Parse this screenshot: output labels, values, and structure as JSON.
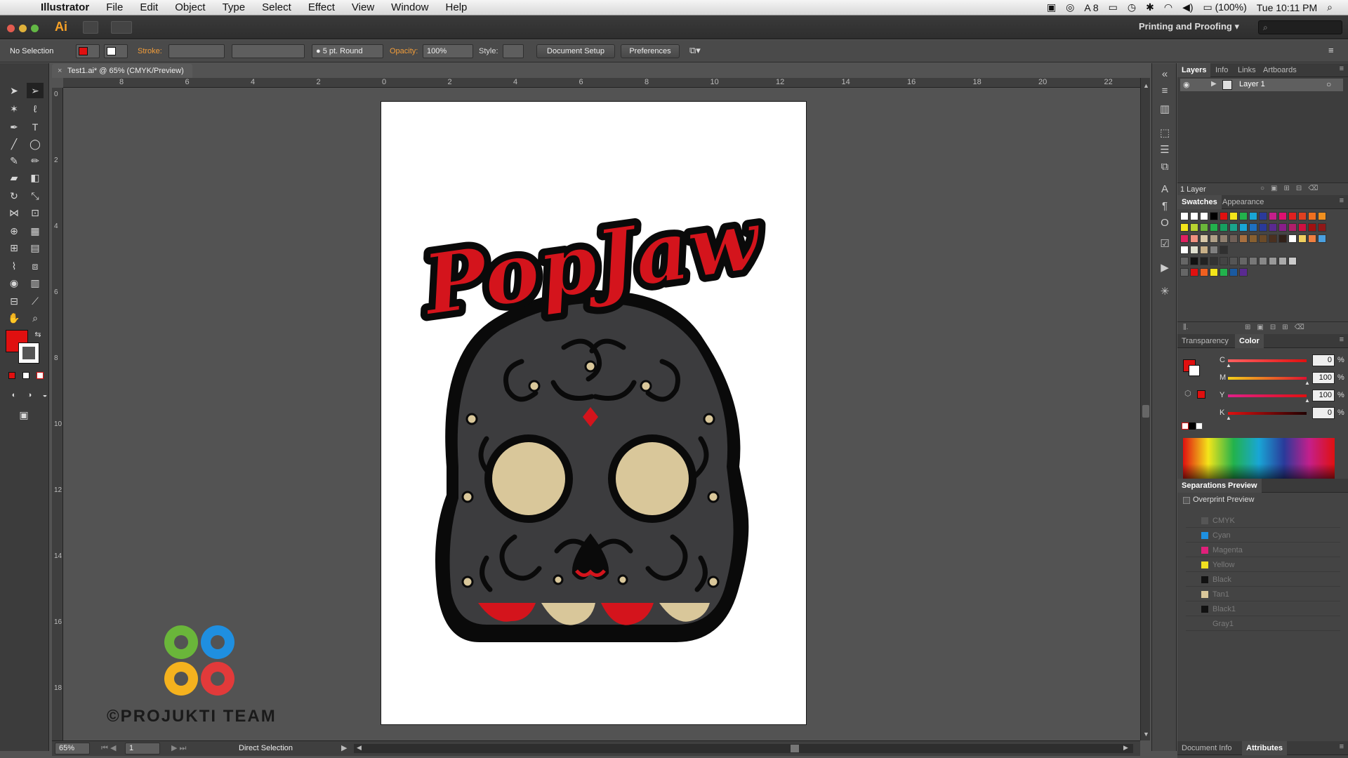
{
  "menubar": {
    "app_name": "Illustrator",
    "items": [
      "File",
      "Edit",
      "Object",
      "Type",
      "Select",
      "Effect",
      "View",
      "Window",
      "Help"
    ],
    "battery": "(100%)",
    "clock": "Tue 10:11 PM",
    "adobe_updates": "8"
  },
  "appbar": {
    "logo": "Ai",
    "workspace": "Printing and Proofing",
    "search_placeholder": "⌕"
  },
  "controlbar": {
    "selection": "No Selection",
    "stroke_label": "Stroke:",
    "brush": "5 pt. Round",
    "opacity_label": "Opacity:",
    "opacity_value": "100%",
    "style_label": "Style:",
    "doc_setup": "Document Setup",
    "preferences": "Preferences"
  },
  "document": {
    "tab_title": "Test1.ai* @ 65% (CMYK/Preview)",
    "ruler_top": [
      "8",
      "6",
      "4",
      "2",
      "0",
      "2",
      "4",
      "6",
      "8",
      "10",
      "12",
      "14",
      "16",
      "18",
      "20",
      "22"
    ],
    "ruler_left": [
      "0",
      "2",
      "4",
      "6",
      "8",
      "10",
      "12",
      "14",
      "16",
      "18"
    ]
  },
  "artwork": {
    "logo_text": "PopJaw",
    "watermark": "©PROJUKTI TEAM"
  },
  "status": {
    "zoom": "65%",
    "artboard": "1",
    "tool": "Direct Selection"
  },
  "panels": {
    "layers_tabs": [
      "Layers",
      "Info",
      "Links",
      "Artboards"
    ],
    "layer_name": "Layer 1",
    "layer_count": "1 Layer",
    "swatch_tabs": [
      "Swatches",
      "Appearance"
    ],
    "color_tabs": [
      "Transparency",
      "Color"
    ],
    "cmyk": [
      {
        "label": "C",
        "value": "0",
        "pct": "%"
      },
      {
        "label": "M",
        "value": "100",
        "pct": "%"
      },
      {
        "label": "Y",
        "value": "100",
        "pct": "%"
      },
      {
        "label": "K",
        "value": "0",
        "pct": "%"
      }
    ],
    "separations_title": "Separations Preview",
    "overprint_label": "Overprint Preview",
    "separations": [
      {
        "name": "CMYK",
        "color": "#555555"
      },
      {
        "name": "Cyan",
        "color": "#1e90e0"
      },
      {
        "name": "Magenta",
        "color": "#e0207a"
      },
      {
        "name": "Yellow",
        "color": "#f0e020"
      },
      {
        "name": "Black",
        "color": "#111111"
      },
      {
        "name": "Tan1",
        "color": "#d9c79a"
      },
      {
        "name": "Black1",
        "color": "#111111"
      },
      {
        "name": "Gray1",
        "color": "#444444"
      }
    ],
    "bottom_tabs": [
      "Document Info",
      "Attributes"
    ]
  },
  "colors": {
    "fill": "#e01010",
    "accent": "#f29d3a",
    "skull_red": "#d4141c",
    "skull_tan": "#d9c79a",
    "skull_gray": "#3c3c3e"
  }
}
